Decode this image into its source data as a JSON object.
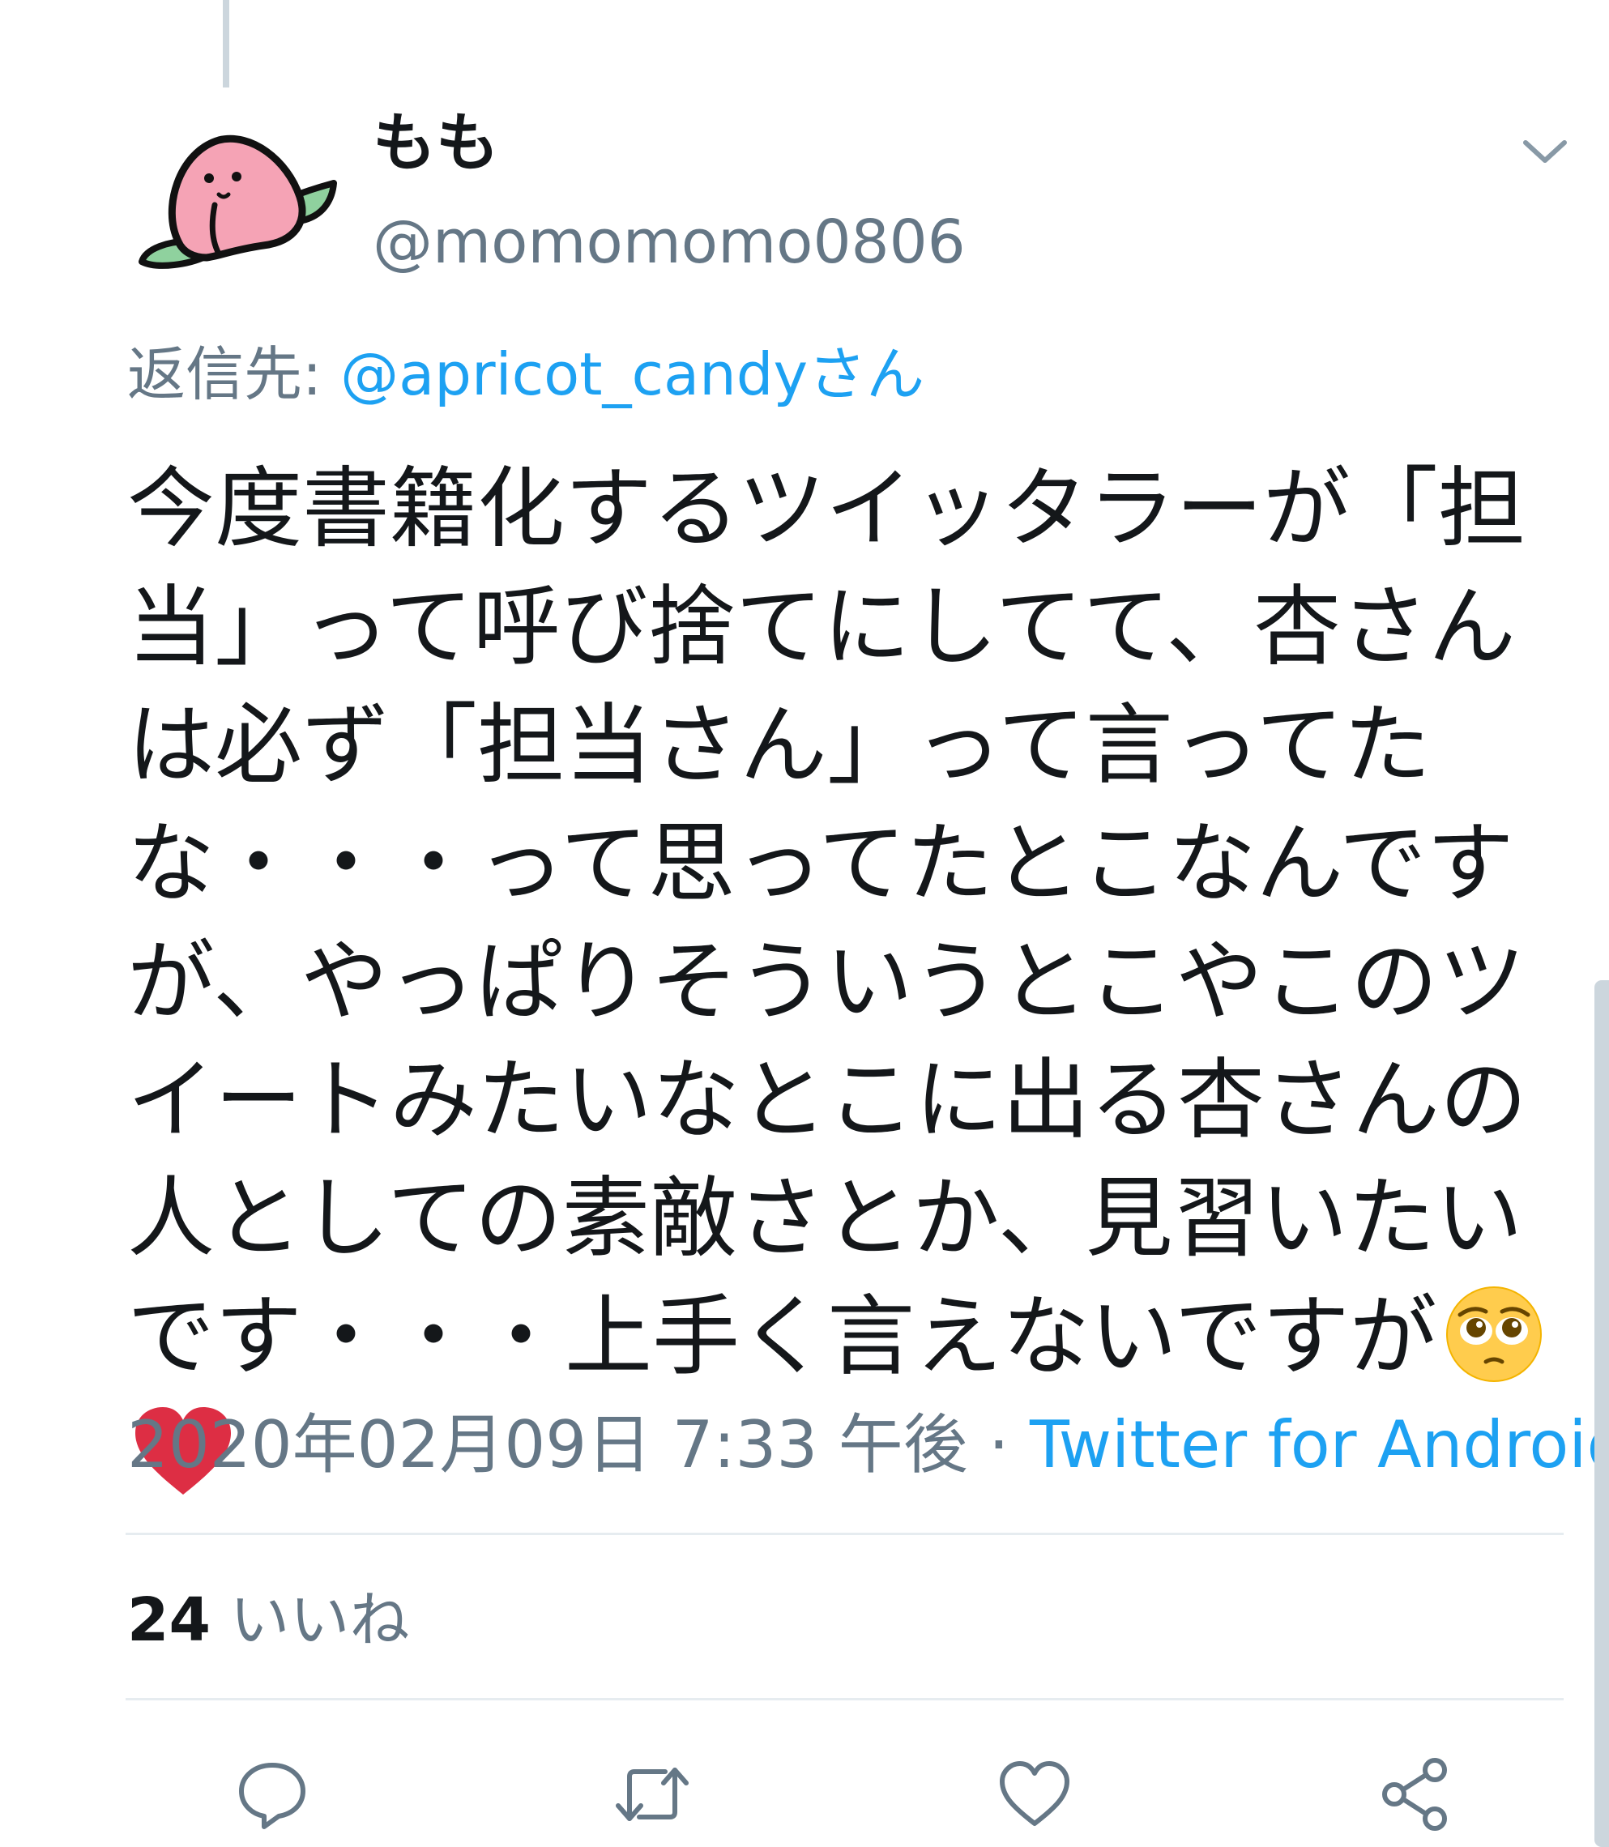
{
  "tweet": {
    "display_name": "もも",
    "handle": "@momomomo0806",
    "reply_prefix": "返信先: ",
    "reply_to": "@apricot_candyさん",
    "text": "今度書籍化するツイッタラーが「担当」って呼び捨てにしてて、杏さんは必ず「担当さん」って言ってたな・・・って思ってたとこなんですが、やっぱりそういうとこやこのツイートみたいなとこに出る杏さんの人としての素敵さとか、見習いたいです・・・上手く言えないですが",
    "emojis": [
      "pleading-face-icon",
      "red-heart-icon"
    ],
    "timestamp": "2020年02月09日 7:33 午後",
    "separator": " · ",
    "source": "Twitter for Android",
    "likes_count": "24",
    "likes_label": " いいね"
  },
  "colors": {
    "primary_text": "#14171a",
    "secondary_text": "#657786",
    "link": "#1da1f2",
    "divider": "#e6ecf0",
    "heart": "#dd2e44"
  },
  "actions": [
    "reply-icon",
    "retweet-icon",
    "like-icon",
    "share-icon"
  ]
}
